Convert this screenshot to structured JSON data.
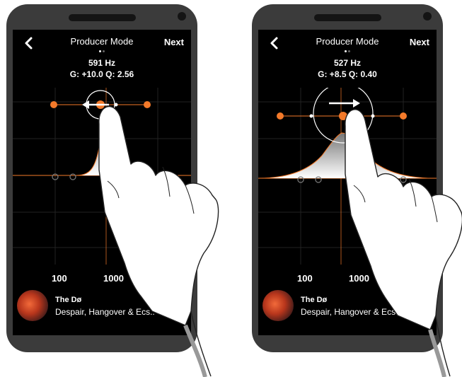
{
  "left": {
    "header": {
      "title": "Producer Mode",
      "next_label": "Next"
    },
    "readout": {
      "frequency": "591 Hz",
      "gain_q": "G: +10.0 Q: 2.56"
    },
    "axis_labels": [
      "100",
      "1000"
    ],
    "now_playing": {
      "artist": "The Dø",
      "album": "Despair, Hangover & Ecs.."
    }
  },
  "right": {
    "header": {
      "title": "Producer Mode",
      "next_label": "Next"
    },
    "readout": {
      "frequency": "527 Hz",
      "gain_q": "G: +8.5 Q: 0.40"
    },
    "axis_labels": [
      "100",
      "1000"
    ],
    "now_playing": {
      "artist": "The Dø",
      "album": "Despair, Hangover & Ecs.."
    }
  },
  "colors": {
    "accent": "#f47a2a",
    "background": "#000000",
    "phone_body": "#3b3b3b"
  },
  "icons": {
    "back": "chevron-left-icon",
    "gesture_left": "arrow-left-icon",
    "gesture_right": "arrow-right-icon",
    "hand": "pointing-hand-icon"
  }
}
